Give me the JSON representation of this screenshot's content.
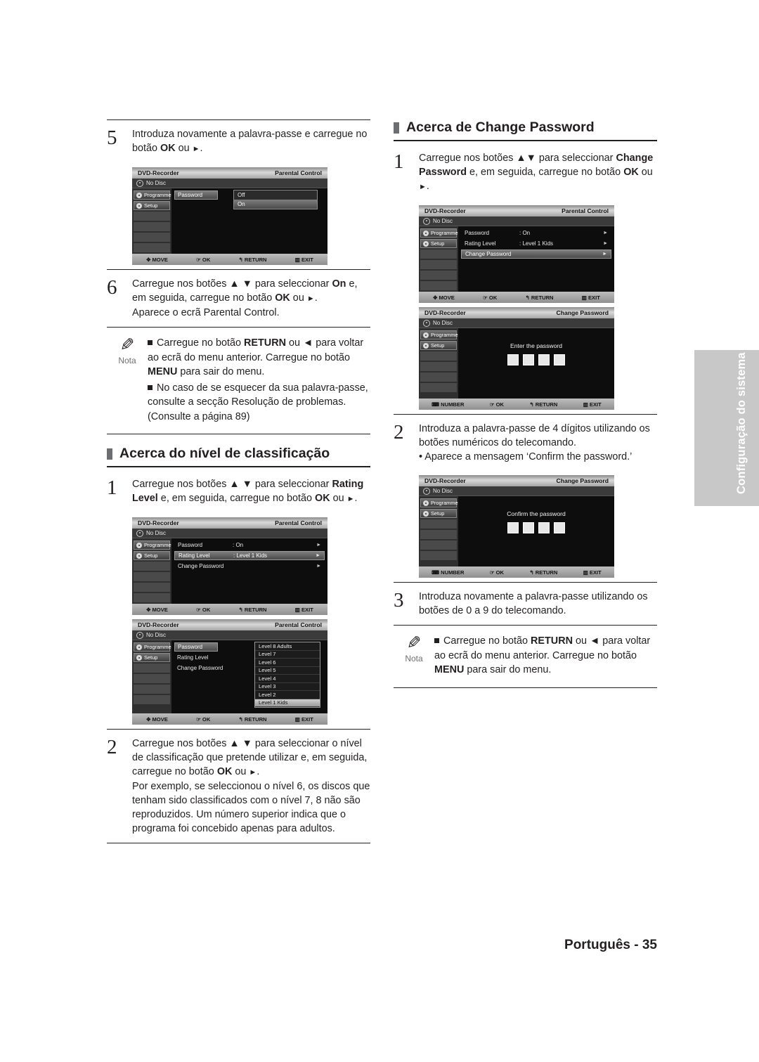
{
  "page": {
    "footer": "Português - 35",
    "side_tab": "Configuração do sistema"
  },
  "left_column": {
    "step5": {
      "num": "5",
      "text": "Introduza novamente a palavra-passe e carregue no botão OK ou ►."
    },
    "osd_password_onoff": {
      "title_left": "DVD-Recorder",
      "title_right": "Parental Control",
      "disc": "No Disc",
      "tab_programme": "Programme",
      "tab_setup": "Setup",
      "row_label": "Password",
      "option_off": "Off",
      "option_on": "On",
      "foot": [
        "MOVE",
        "OK",
        "RETURN",
        "EXIT"
      ]
    },
    "step6": {
      "num": "6",
      "text_1": "Carregue nos botões ▲▼ para seleccionar ",
      "bold_on": "On",
      "text_2": " e, em seguida, carregue no botão ",
      "bold_ok": "OK",
      "text_3": " ou ►.",
      "text_4": "Aparece o ecrã Parental Control."
    },
    "note1": {
      "label": "Nota",
      "b1_pre": "Carregue no botão ",
      "b1_bold": "RETURN",
      "b1_mid": " ou ◄ para voltar ao ecrã do menu anterior. Carregue no botão ",
      "b1_bold2": "MENU",
      "b1_end": " para sair do menu.",
      "b2": "No caso de se esquecer da sua palavra-passe, consulte a secção Resolução de problemas. (Consulte a página 89)"
    },
    "heading2": "Acerca do nível de classificação",
    "step1": {
      "num": "1",
      "text_1": "Carregue nos botões ▲▼ para seleccionar ",
      "bold_1": "Rating Level",
      "text_2": " e, em seguida, carregue no botão ",
      "bold_2": "OK",
      "text_3": " ou ►."
    },
    "osd_parental": {
      "title_left": "DVD-Recorder",
      "title_right": "Parental Control",
      "disc": "No Disc",
      "tab_programme": "Programme",
      "tab_setup": "Setup",
      "rows": [
        {
          "label": "Password",
          "value": ": On",
          "selected": false
        },
        {
          "label": "Rating Level",
          "value": ": Level 1 Kids",
          "selected": true
        },
        {
          "label": "Change Password",
          "value": "",
          "selected": false
        }
      ],
      "foot": [
        "MOVE",
        "OK",
        "RETURN",
        "EXIT"
      ]
    },
    "osd_levels": {
      "title_left": "DVD-Recorder",
      "title_right": "Parental Control",
      "disc": "No Disc",
      "tab_programme": "Programme",
      "tab_setup": "Setup",
      "rows": [
        {
          "label": "Password",
          "selected": false
        },
        {
          "label": "Rating Level",
          "selected": false
        },
        {
          "label": "Change Password",
          "selected": false
        }
      ],
      "levels": [
        "Level 8 Adults",
        "Level 7",
        "Level 6",
        "Level 5",
        "Level 4",
        "Level 3",
        "Level 2",
        "Level 1 Kids"
      ],
      "level_highlighted": "Level 1 Kids",
      "foot": [
        "MOVE",
        "OK",
        "RETURN",
        "EXIT"
      ]
    },
    "step2": {
      "num": "2",
      "text_1": "Carregue nos botões ▲▼ para seleccionar o nível de classificação que pretende utilizar e, em seguida, carregue no botão ",
      "bold_1": "OK",
      "text_2": " ou ►.",
      "text_3": "Por exemplo, se seleccionou o nível 6, os discos que tenham sido classificados com o nível 7, 8 não são reproduzidos. Um número superior indica que o programa foi concebido apenas para adultos."
    }
  },
  "right_column": {
    "heading1": "Acerca de Change Password",
    "step1": {
      "num": "1",
      "text_1": "Carregue nos botões ▲▼ para seleccionar ",
      "bold_1": "Change Password",
      "text_2": " e, em seguida, carregue no botão ",
      "bold_2": "OK",
      "text_3": " ou ►."
    },
    "osd_parental": {
      "title_left": "DVD-Recorder",
      "title_right": "Parental Control",
      "disc": "No Disc",
      "tab_programme": "Programme",
      "tab_setup": "Setup",
      "rows": [
        {
          "label": "Password",
          "value": ": On",
          "selected": false
        },
        {
          "label": "Rating Level",
          "value": ": Level 1 Kids",
          "selected": false
        },
        {
          "label": "Change Password",
          "value": "",
          "selected": true
        }
      ],
      "foot": [
        "MOVE",
        "OK",
        "RETURN",
        "EXIT"
      ]
    },
    "osd_enter_password": {
      "title_left": "DVD-Recorder",
      "title_right": "Change Password",
      "disc": "No Disc",
      "tab_programme": "Programme",
      "tab_setup": "Setup",
      "caption": "Enter the password",
      "digits": 4,
      "foot": [
        "NUMBER",
        "OK",
        "RETURN",
        "EXIT"
      ]
    },
    "step2": {
      "num": "2",
      "text_1": "Introduza a palavra-passe de 4 dígitos utilizando os botões numéricos do telecomando.",
      "text_2": "• Aparece a mensagem ‘Confirm the password.’"
    },
    "osd_confirm_password": {
      "title_left": "DVD-Recorder",
      "title_right": "Change Password",
      "disc": "No Disc",
      "tab_programme": "Programme",
      "tab_setup": "Setup",
      "caption": "Confirm the password",
      "digits": 4,
      "foot": [
        "NUMBER",
        "OK",
        "RETURN",
        "EXIT"
      ]
    },
    "step3": {
      "num": "3",
      "text": "Introduza novamente a palavra-passe utilizando os botões de 0 a 9 do telecomando."
    },
    "note1": {
      "label": "Nota",
      "b1_pre": "Carregue no botão ",
      "b1_bold": "RETURN",
      "b1_mid": " ou ◄ para voltar ao ecrã do menu anterior. Carregue no botão ",
      "b1_bold2": "MENU",
      "b1_end": " para sair do menu."
    }
  }
}
